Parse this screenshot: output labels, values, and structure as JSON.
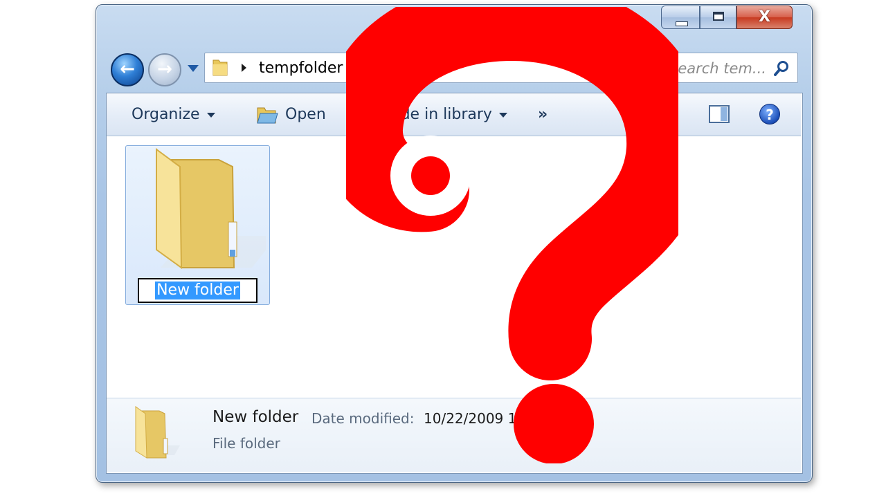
{
  "window": {
    "caption_buttons": {
      "minimize": "minimize",
      "maximize": "maximize",
      "close": "X"
    }
  },
  "navigation": {
    "back_icon": "back-arrow-icon",
    "forward_icon": "forward-arrow-icon",
    "breadcrumb": [
      "tempfolder"
    ],
    "search_placeholder": "Search tem..."
  },
  "toolbar": {
    "organize_label": "Organize",
    "open_label": "Open",
    "include_label": "Include in library",
    "more_label": "»"
  },
  "content": {
    "items": [
      {
        "name": "New folder",
        "type": "folder",
        "state": "renaming"
      }
    ]
  },
  "details": {
    "name": "New folder",
    "date_label": "Date modified:",
    "date_value": "10/22/2009 1",
    "type": "File folder"
  },
  "overlay": {
    "symbol": "?",
    "color": "#ff0000"
  }
}
